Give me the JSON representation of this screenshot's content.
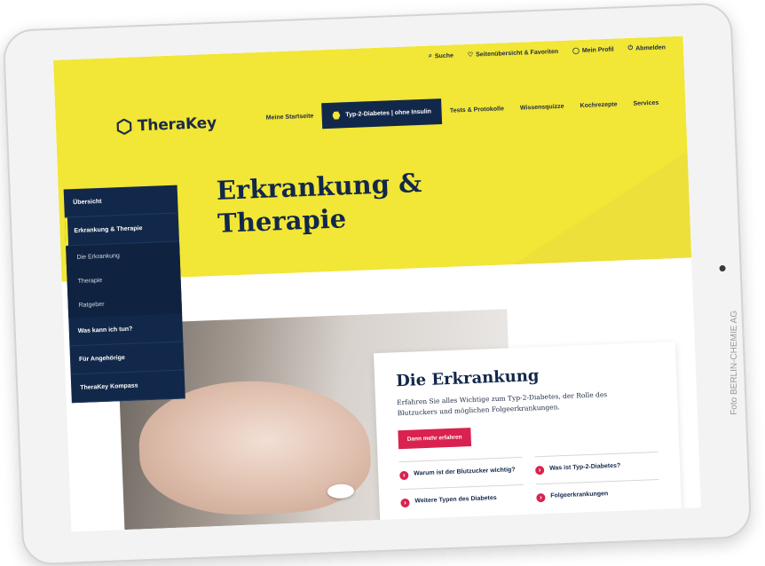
{
  "utility_nav": [
    {
      "icon": "search-icon",
      "label": "Suche"
    },
    {
      "icon": "heart-icon",
      "label": "Seitenübersicht & Favoriten"
    },
    {
      "icon": "user-icon",
      "label": "Mein Profil"
    },
    {
      "icon": "power-icon",
      "label": "Abmelden"
    }
  ],
  "logo": {
    "text": "TheraKey"
  },
  "main_nav": [
    {
      "label": "Meine Startseite"
    },
    {
      "label": "Typ-2-Diabetes | ohne Insulin",
      "active": true
    },
    {
      "label": "Tests & Protokolle"
    },
    {
      "label": "Wissensquizze"
    },
    {
      "label": "Kochrezepte"
    },
    {
      "label": "Services"
    }
  ],
  "page_title": {
    "line1": "Erkrankung &",
    "line2": "Therapie"
  },
  "sidebar": {
    "items": [
      {
        "label": "Übersicht"
      },
      {
        "label": "Erkrankung & Therapie"
      },
      {
        "label": "Die Erkrankung"
      },
      {
        "label": "Therapie"
      },
      {
        "label": "Ratgeber"
      },
      {
        "label": "Was kann ich tun?"
      },
      {
        "label": "Für Angehörige"
      },
      {
        "label": "TheraKey Kompass"
      }
    ]
  },
  "card": {
    "title": "Die Erkrankung",
    "text": "Erfahren Sie alles Wichtige zum Typ-2-Diabetes, der Rolle des Blutzuckers und möglichen Folgeerkrankungen.",
    "button": "Dann mehr erfahren",
    "links": [
      {
        "label": "Warum ist der Blutzucker wichtig?"
      },
      {
        "label": "Was ist Typ-2-Diabetes?"
      },
      {
        "label": "Weitere Typen des Diabetes"
      },
      {
        "label": "Folgeerkrankungen"
      }
    ]
  },
  "photo_credit": "Foto BERLIN-CHEMIE AG",
  "colors": {
    "brand_yellow": "#f2e636",
    "navy": "#12284a",
    "accent_red": "#d9224f"
  }
}
